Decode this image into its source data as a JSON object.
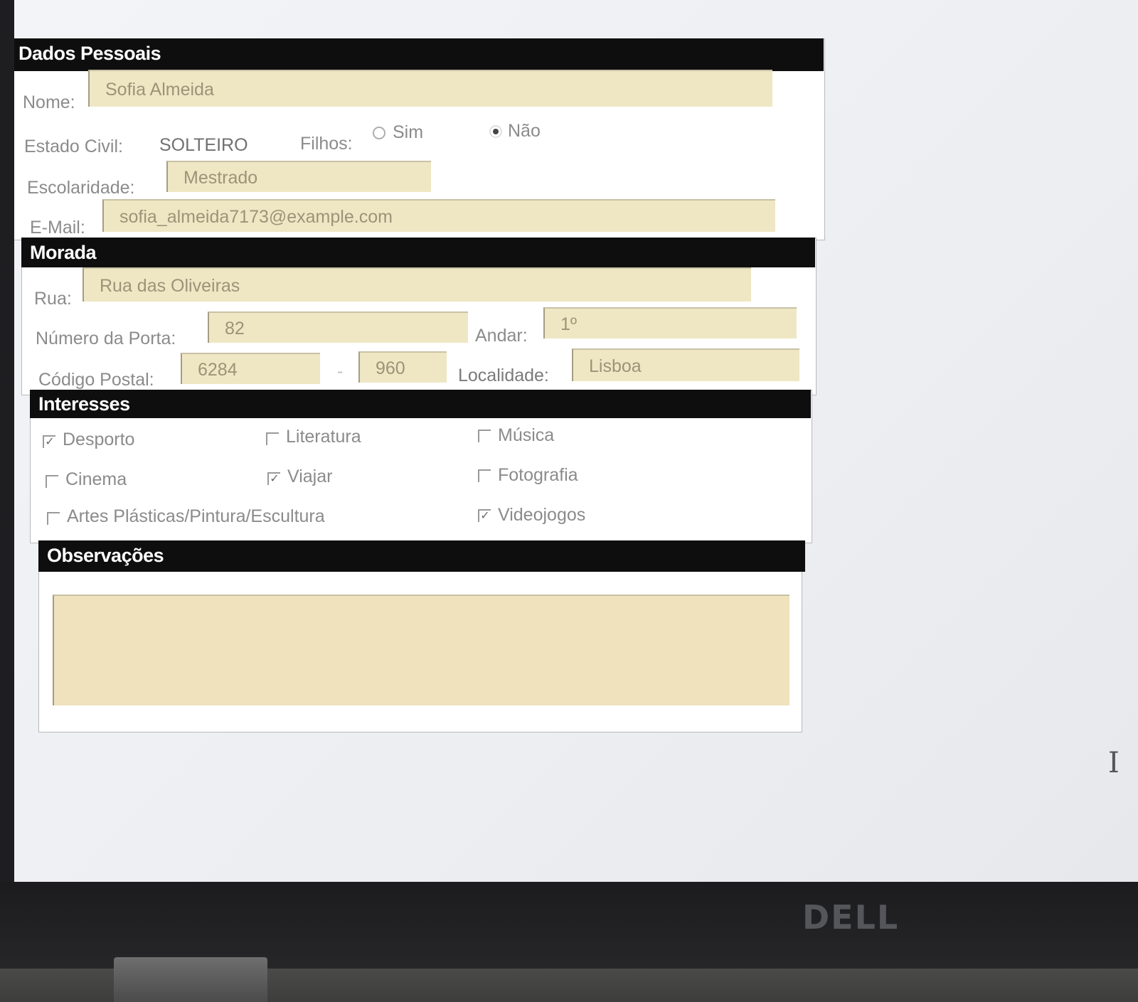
{
  "dados_pessoais": {
    "header": "Dados Pessoais",
    "nome_label": "Nome:",
    "nome_value": "Sofia Almeida",
    "estado_civil_label": "Estado Civil:",
    "estado_civil_value": "SOLTEIRO",
    "filhos_label": "Filhos:",
    "filhos_options": [
      "Sim",
      "Não"
    ],
    "filhos_selected": "Não",
    "escolaridade_label": "Escolaridade:",
    "escolaridade_value": "Mestrado",
    "email_label": "E-Mail:",
    "email_value": "sofia_almeida7173@example.com"
  },
  "morada": {
    "header": "Morada",
    "rua_label": "Rua:",
    "rua_value": "Rua das Oliveiras",
    "numero_label": "Número da Porta:",
    "numero_value": "82",
    "andar_label": "Andar:",
    "andar_value": "1º",
    "codigo_postal_label": "Código Postal:",
    "codigo_postal_1": "6284",
    "codigo_postal_sep": "-",
    "codigo_postal_2": "960",
    "localidade_label": "Localidade:",
    "localidade_value": "Lisboa"
  },
  "interesses": {
    "header": "Interesses",
    "items": [
      {
        "label": "Desporto",
        "checked": true
      },
      {
        "label": "Literatura",
        "checked": false
      },
      {
        "label": "Música",
        "checked": false
      },
      {
        "label": "Cinema",
        "checked": false
      },
      {
        "label": "Viajar",
        "checked": true
      },
      {
        "label": "Fotografia",
        "checked": false
      },
      {
        "label": "Artes Plásticas/Pintura/Escultura",
        "checked": false
      },
      {
        "label": "Videojogos",
        "checked": true
      }
    ]
  },
  "observacoes": {
    "header": "Observações",
    "value": ""
  },
  "device": {
    "brand": "DELL"
  },
  "colors": {
    "field_bg": "#efe7c4",
    "header_bg": "#0e0e0e",
    "screen_bg": "#eef0f3"
  }
}
